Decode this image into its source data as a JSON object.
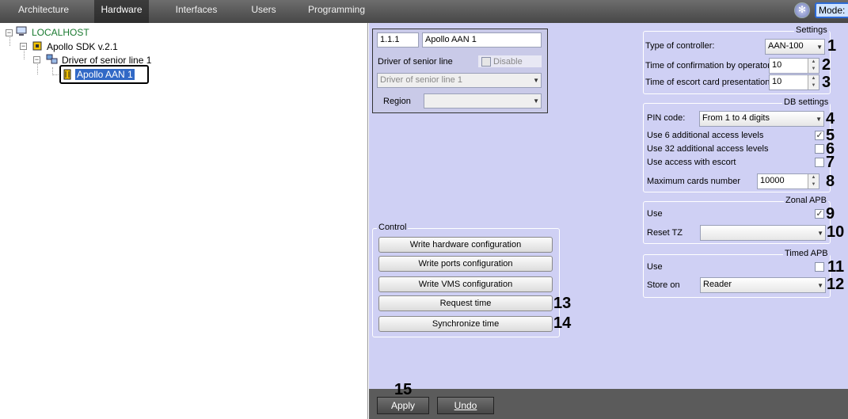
{
  "tabs": [
    "Architecture",
    "Hardware",
    "Interfaces",
    "Users",
    "Programming"
  ],
  "mode_label": "Mode: D",
  "tree": {
    "root": "LOCALHOST",
    "sdk": "Apollo SDK v.2.1",
    "driver": "Driver of senior line 1",
    "device": "Apollo AAN 1"
  },
  "device_box": {
    "id": "1.1.1",
    "name": "Apollo AAN 1",
    "driver_label": "Driver of senior line",
    "disable_label": "Disable",
    "driver_value": "Driver of senior line 1",
    "region_label": "Region",
    "region_value": ""
  },
  "settings": {
    "title": "Settings",
    "controller_label": "Type of controller:",
    "controller_value": "AAN-100",
    "confirm_label": "Time of confirmation by operator:",
    "confirm_value": "10",
    "escort_label": "Time of escort card presentation:",
    "escort_value": "10"
  },
  "db": {
    "title": "DB settings",
    "pin_label": "PIN code:",
    "pin_value": "From 1 to 4 digits",
    "use6_label": "Use 6 additional access levels",
    "use6_checked": true,
    "use32_label": "Use 32 additional access levels",
    "use32_checked": false,
    "escort_label": "Use access with escort",
    "escort_checked": false,
    "maxcards_label": "Maximum cards number",
    "maxcards_value": "10000"
  },
  "zonal": {
    "title": "Zonal APB",
    "use_label": "Use",
    "use_checked": true,
    "reset_label": "Reset TZ",
    "reset_value": ""
  },
  "timed": {
    "title": "Timed APB",
    "use_label": "Use",
    "use_checked": false,
    "store_label": "Store on",
    "store_value": "Reader"
  },
  "control": {
    "title": "Control",
    "buttons": [
      "Write hardware configuration",
      "Write ports configuration",
      "Write VMS configuration",
      "Request time",
      "Synchronize time"
    ]
  },
  "footer": {
    "apply": "Apply",
    "undo": "Undo"
  },
  "callouts": [
    "1",
    "2",
    "3",
    "4",
    "5",
    "6",
    "7",
    "8",
    "9",
    "10",
    "11",
    "12",
    "13",
    "14",
    "15"
  ]
}
